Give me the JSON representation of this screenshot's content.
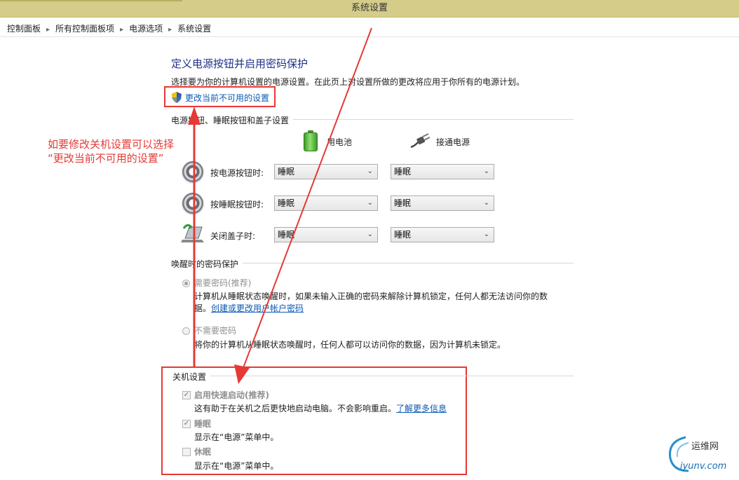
{
  "window": {
    "title": "系统设置"
  },
  "breadcrumb": [
    "控制面板",
    "所有控制面板项",
    "电源选项",
    "系统设置"
  ],
  "page": {
    "title": "定义电源按钮并启用密码保护",
    "description": "选择要为你的计算机设置的电源设置。在此页上对设置所做的更改将应用于你所有的电源计划。",
    "change_link": "更改当前不可用的设置"
  },
  "buttons_section": {
    "title": "电源按钮、睡眠按钮和盖子设置",
    "col_battery": "用电池",
    "col_plugged": "接通电源",
    "rows": [
      {
        "label": "按电源按钮时:",
        "battery": "睡眠",
        "plugged": "睡眠"
      },
      {
        "label": "按睡眠按钮时:",
        "battery": "睡眠",
        "plugged": "睡眠"
      },
      {
        "label": "关闭盖子时:",
        "battery": "睡眠",
        "plugged": "睡眠"
      }
    ]
  },
  "password_section": {
    "title": "唤醒时的密码保护",
    "require_label": "需要密码(推荐)",
    "require_desc_1": "计算机从睡眠状态唤醒时，如果未输入正确的密码来解除计算机锁定，任何人都无法访问你的数",
    "require_desc_2": "据。",
    "create_link": "创建或更改用户帐户密码",
    "no_require_label": "不需要密码",
    "no_require_desc": "将你的计算机从睡眠状态唤醒时，任何人都可以访问你的数据，因为计算机未锁定。"
  },
  "shutdown_section": {
    "title": "关机设置",
    "fast_startup_label": "启用快速启动(推荐)",
    "fast_startup_desc": "这有助于在关机之后更快地启动电脑。不会影响重启。",
    "learn_more": "了解更多信息",
    "sleep_label": "睡眠",
    "sleep_desc": "显示在“电源”菜单中。",
    "hibernate_label": "休眠",
    "hibernate_desc": "显示在“电源”菜单中。",
    "fast_startup_checked": true,
    "sleep_checked": true,
    "hibernate_checked": false
  },
  "annotation": {
    "line1": "如要修改关机设置可以选择",
    "line2": "“更改当前不可用的设置”",
    "color": "#e53935"
  },
  "watermark": {
    "brand": "运维网",
    "site": "iyunv.com"
  }
}
